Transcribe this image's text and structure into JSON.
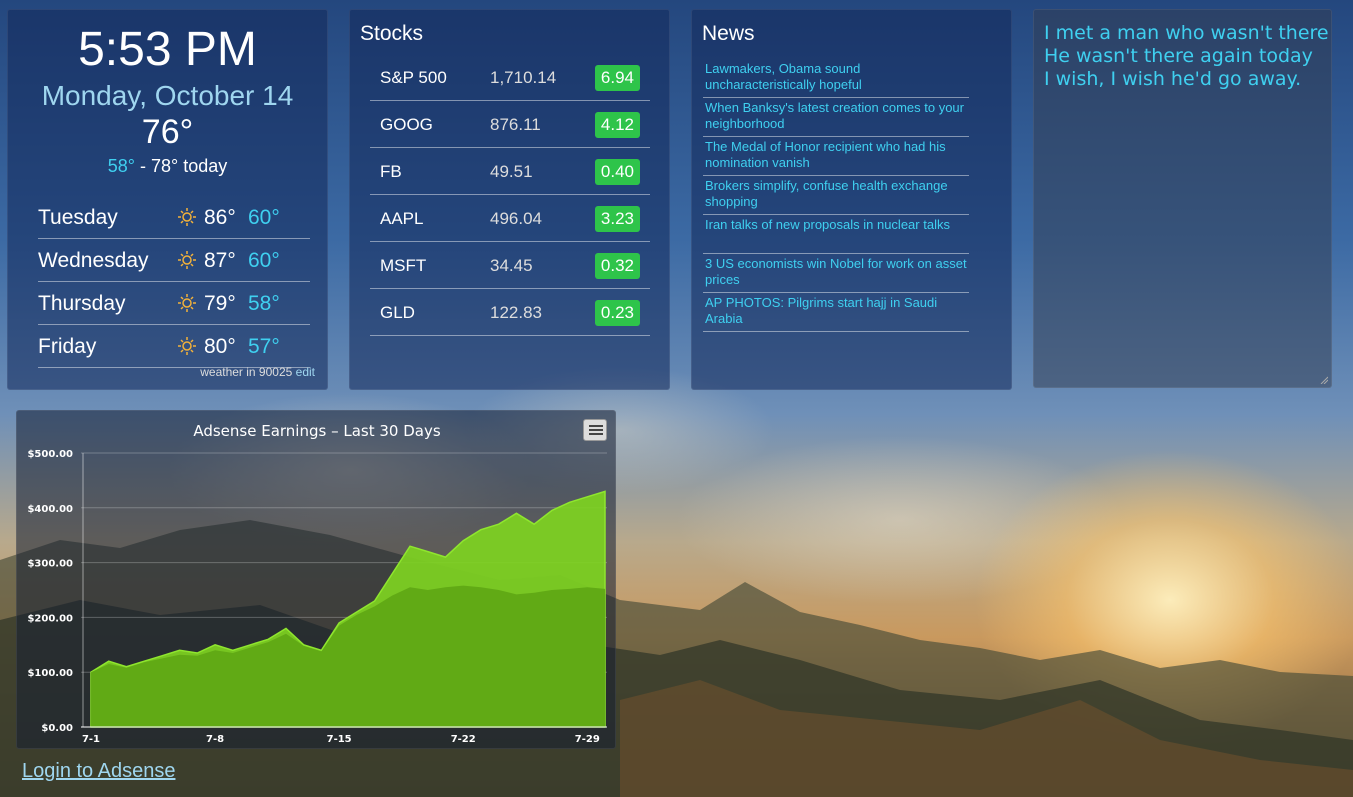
{
  "weather": {
    "time": "5:53 PM",
    "date": "Monday, October 14",
    "current_temp": "76°",
    "low": "58°",
    "high_text": " - 78° today",
    "forecast": [
      {
        "day": "Tuesday",
        "hi": "86°",
        "lo": "60°",
        "icon": "sun-icon"
      },
      {
        "day": "Wednesday",
        "hi": "87°",
        "lo": "60°",
        "icon": "sun-icon"
      },
      {
        "day": "Thursday",
        "hi": "79°",
        "lo": "58°",
        "icon": "sun-icon"
      },
      {
        "day": "Friday",
        "hi": "80°",
        "lo": "57°",
        "icon": "sun-icon"
      }
    ],
    "footer_text": "weather in 90025 ",
    "edit_label": "edit"
  },
  "stocks": {
    "title": "Stocks",
    "rows": [
      {
        "symbol": "S&P 500",
        "price": "1,710.14",
        "change": "6.94"
      },
      {
        "symbol": "GOOG",
        "price": "876.11",
        "change": "4.12"
      },
      {
        "symbol": "FB",
        "price": "49.51",
        "change": "0.40"
      },
      {
        "symbol": "AAPL",
        "price": "496.04",
        "change": "3.23"
      },
      {
        "symbol": "MSFT",
        "price": "34.45",
        "change": "0.32"
      },
      {
        "symbol": "GLD",
        "price": "122.83",
        "change": "0.23"
      }
    ],
    "change_color": "#2ec44a"
  },
  "news": {
    "title": "News",
    "items": [
      "Lawmakers, Obama sound uncharacteristically hopeful",
      "When Banksy's latest creation comes to your neighborhood",
      "The Medal of Honor recipient who had his nomination vanish",
      "Brokers simplify, confuse health exchange shopping",
      "Iran talks of new proposals in nuclear talks",
      "3 US economists win Nobel for work on asset prices",
      "AP PHOTOS: Pilgrims start hajj in Saudi Arabia"
    ]
  },
  "quote": {
    "text": "I met a man who wasn't there\nHe wasn't there again today\nI wish, I wish he'd go away."
  },
  "chart_data": {
    "type": "area",
    "title": "Adsense Earnings – Last 30 Days",
    "x": [
      "7-1",
      "7-2",
      "7-3",
      "7-4",
      "7-5",
      "7-6",
      "7-7",
      "7-8",
      "7-9",
      "7-10",
      "7-11",
      "7-12",
      "7-13",
      "7-14",
      "7-15",
      "7-16",
      "7-17",
      "7-18",
      "7-19",
      "7-20",
      "7-21",
      "7-22",
      "7-23",
      "7-24",
      "7-25",
      "7-26",
      "7-27",
      "7-28",
      "7-29",
      "7-30"
    ],
    "xticks": [
      "7-1",
      "7-8",
      "7-15",
      "7-22",
      "7-29"
    ],
    "series": [
      {
        "values": [
          100,
          120,
          110,
          120,
          130,
          140,
          135,
          150,
          140,
          150,
          160,
          180,
          150,
          140,
          190,
          210,
          230,
          280,
          330,
          320,
          310,
          340,
          360,
          370,
          390,
          370,
          395,
          410,
          420,
          430
        ],
        "color": "#7ed321"
      },
      {
        "values": [
          100,
          115,
          108,
          118,
          125,
          132,
          130,
          140,
          135,
          145,
          155,
          170,
          148,
          138,
          185,
          205,
          220,
          240,
          255,
          250,
          255,
          258,
          255,
          250,
          242,
          245,
          250,
          252,
          255,
          252
        ],
        "color": "#5ea614"
      }
    ],
    "ylim": [
      0,
      500
    ],
    "yticks": [
      "$0.00",
      "$100.00",
      "$200.00",
      "$300.00",
      "$400.00",
      "$500.00"
    ],
    "grid": true
  },
  "chart_menu_icon": "menu-icon",
  "login_link": "Login to Adsense"
}
